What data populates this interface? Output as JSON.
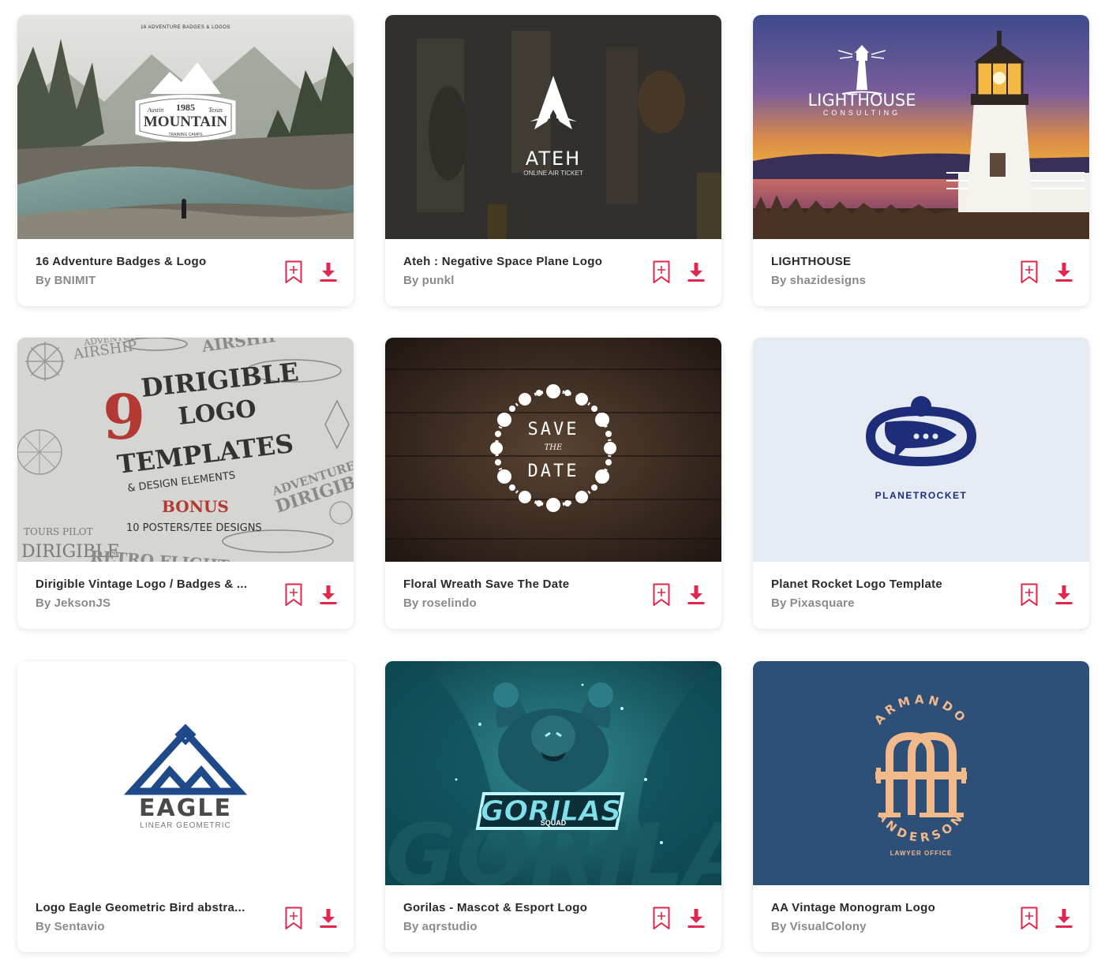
{
  "accent_color": "#e2264d",
  "cards": [
    {
      "title": "16 Adventure Badges & Logo",
      "author": "BNIMIT",
      "by": "By",
      "art": {
        "header": "16 ADVENTURE BADGES & LOGOS",
        "year": "1985",
        "left": "Austin",
        "right": "Texas",
        "word": "MOUNTAIN",
        "sub": "TRAINING CAMPS"
      }
    },
    {
      "title": "Ateh : Negative Space Plane Logo",
      "author": "punkl",
      "by": "By",
      "art": {
        "word": "ATEH",
        "sub": "ONLINE AIR TICKET"
      }
    },
    {
      "title": "LIGHTHOUSE",
      "author": "shazidesigns",
      "by": "By",
      "art": {
        "word": "LIGHTHOUSE",
        "sub": "CONSULTING"
      }
    },
    {
      "title": "Dirigible Vintage Logo / Badges & ...",
      "author": "JeksonJS",
      "by": "By",
      "art": {
        "num": "9",
        "line1": "DIRIGIBLE",
        "line2": "LOGO",
        "line3": "TEMPLATES",
        "line4": "& DESIGN ELEMENTS",
        "bonus": "BONUS",
        "line5": "10 POSTERS/TEE DESIGNS",
        "tl": "ADVENTURES",
        "tl2": "AIRSHIP",
        "tr": "AIRSHIP",
        "bl1": "TOURS PILOT",
        "bl2": "DIRIGIBLE",
        "bl3": "RETRO FLIGHT",
        "r1": "ADVENTURES",
        "r2": "DIRIGIBL"
      }
    },
    {
      "title": "Floral Wreath Save The Date",
      "author": "roselindo",
      "by": "By",
      "art": {
        "l1": "SAVE",
        "l2": "THE",
        "l3": "DATE"
      }
    },
    {
      "title": "Planet Rocket Logo Template",
      "author": "Pixasquare",
      "by": "By",
      "art": {
        "word": "PLANETROCKET"
      }
    },
    {
      "title": "Logo Eagle Geometric Bird abstra...",
      "author": "Sentavio",
      "by": "By",
      "art": {
        "word": "EAGLE",
        "sub": "LINEAR GEOMETRIC"
      }
    },
    {
      "title": "Gorilas - Mascot & Esport Logo",
      "author": "aqrstudio",
      "by": "By",
      "art": {
        "word": "GORILAS",
        "sub": "SQUAD"
      }
    },
    {
      "title": "AA Vintage Monogram Logo",
      "author": "VisualColony",
      "by": "By",
      "art": {
        "top": "ARMANDO",
        "bottom": "ANDERSON",
        "sub": "LAWYER OFFICE"
      }
    }
  ]
}
